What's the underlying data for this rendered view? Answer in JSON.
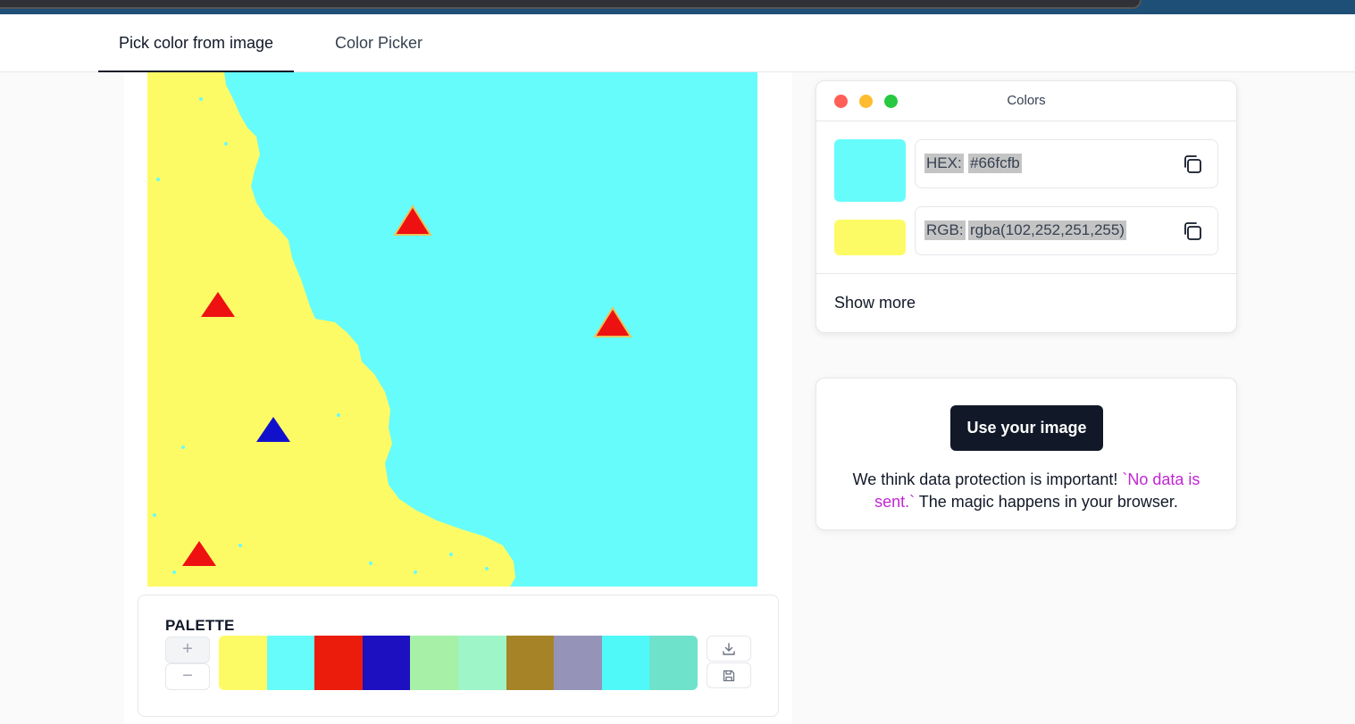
{
  "tabs": [
    {
      "label": "Pick color from image",
      "active": true
    },
    {
      "label": "Color Picker",
      "active": false
    }
  ],
  "image": {
    "colors": {
      "sea": "#66fcfb",
      "land": "#fdfb65",
      "marker_red": "#ee1111",
      "marker_blue": "#1111cc"
    }
  },
  "palette": {
    "title": "PALETTE",
    "add_label": "+",
    "remove_label": "−",
    "swatches": [
      "#fdfb65",
      "#66fcfb",
      "#ec1c0d",
      "#1c10c0",
      "#a7f0a7",
      "#9ef5c8",
      "#a68326",
      "#9594b8",
      "#4ff9f8",
      "#6fe2cc"
    ],
    "download_icon": "download-icon",
    "save_icon": "save-icon"
  },
  "colors_panel": {
    "title": "Colors",
    "primary_color": "#66fcfb",
    "secondary_color": "#fdfb65",
    "hex_label": "HEX:",
    "hex_value": "#66fcfb",
    "rgb_label": "RGB:",
    "rgb_value": "rgba(102,252,251,255)",
    "copy_icon": "copy-icon",
    "show_more": "Show more"
  },
  "upload": {
    "button_label": "Use your image",
    "text_before": "We think data protection is important! ",
    "text_highlight": "`No data is sent.`",
    "text_after": " The magic happens in your browser."
  }
}
